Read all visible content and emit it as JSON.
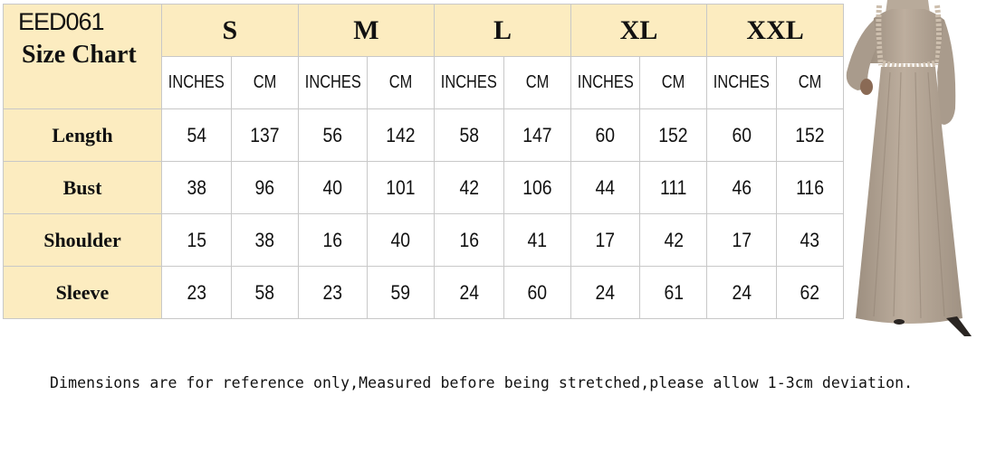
{
  "chart": {
    "code": "EED061",
    "title": "Size Chart",
    "sizes": [
      "S",
      "M",
      "L",
      "XL",
      "XXL"
    ],
    "units": [
      "INCHES",
      "CM"
    ],
    "rows": [
      {
        "label": "Length",
        "values": [
          "54",
          "137",
          "56",
          "142",
          "58",
          "147",
          "60",
          "152",
          "60",
          "152"
        ]
      },
      {
        "label": "Bust",
        "values": [
          "38",
          "96",
          "40",
          "101",
          "42",
          "106",
          "44",
          "111",
          "46",
          "116"
        ]
      },
      {
        "label": "Shoulder",
        "values": [
          "15",
          "38",
          "16",
          "40",
          "16",
          "41",
          "17",
          "42",
          "17",
          "43"
        ]
      },
      {
        "label": "Sleeve",
        "values": [
          "23",
          "58",
          "23",
          "59",
          "24",
          "60",
          "24",
          "61",
          "24",
          "62"
        ]
      }
    ]
  },
  "note": "Dimensions are for reference only,Measured before being stretched,please allow 1-3cm deviation.",
  "colors": {
    "header_bg": "#fcecc0",
    "grid": "#c8c8c8",
    "dress": "#b3a595"
  }
}
